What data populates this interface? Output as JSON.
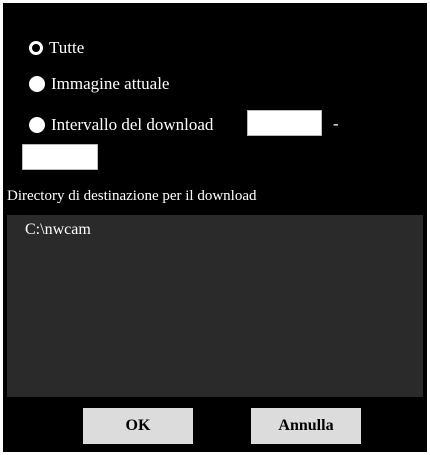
{
  "options": {
    "all_label": "Tutte",
    "current_label": "Immagine attuale",
    "range_label": "Intervallo del download",
    "range_separator": "-",
    "selected": "all"
  },
  "range": {
    "start_value": "",
    "end_value": ""
  },
  "destination": {
    "label": "Directory di destinazione per il download",
    "path": "C:\\nwcam"
  },
  "buttons": {
    "ok_label": "OK",
    "cancel_label": "Annulla"
  },
  "colors": {
    "dialog_bg": "#000000",
    "path_box_bg": "#2a2a2a",
    "button_bg": "#dcdcdc"
  }
}
